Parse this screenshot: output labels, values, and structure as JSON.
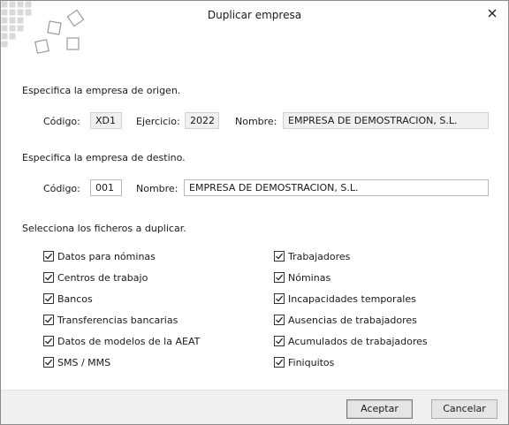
{
  "window": {
    "title": "Duplicar empresa",
    "close_icon": "close-icon"
  },
  "origin": {
    "heading": "Especifica la empresa de origen.",
    "codigo_label": "Código:",
    "codigo_value": "XD1",
    "ejercicio_label": "Ejercicio:",
    "ejercicio_value": "2022",
    "nombre_label": "Nombre:",
    "nombre_value": "EMPRESA DE DEMOSTRACION, S.L."
  },
  "destination": {
    "heading": "Especifica la empresa de destino.",
    "codigo_label": "Código:",
    "codigo_value": "001",
    "nombre_label": "Nombre:",
    "nombre_value": "EMPRESA DE DEMOSTRACION, S.L."
  },
  "files": {
    "heading": "Selecciona los ficheros a duplicar.",
    "left": [
      {
        "label": "Datos para nóminas",
        "checked": true
      },
      {
        "label": "Centros de trabajo",
        "checked": true
      },
      {
        "label": "Bancos",
        "checked": true
      },
      {
        "label": "Transferencias bancarias",
        "checked": true
      },
      {
        "label": "Datos de modelos de la AEAT",
        "checked": true
      },
      {
        "label": "SMS / MMS",
        "checked": true
      }
    ],
    "right": [
      {
        "label": "Trabajadores",
        "checked": true
      },
      {
        "label": "Nóminas",
        "checked": true
      },
      {
        "label": "Incapacidades temporales",
        "checked": true
      },
      {
        "label": "Ausencias de trabajadores",
        "checked": true
      },
      {
        "label": "Acumulados de trabajadores",
        "checked": true
      },
      {
        "label": "Finiquitos",
        "checked": true
      }
    ]
  },
  "footer": {
    "accept_label": "Aceptar",
    "cancel_label": "Cancelar"
  },
  "colors": {
    "footer_bg": "#f0f0f0",
    "readonly_bg": "#f0f0f0",
    "logo_gray": "#c8c8c8"
  }
}
